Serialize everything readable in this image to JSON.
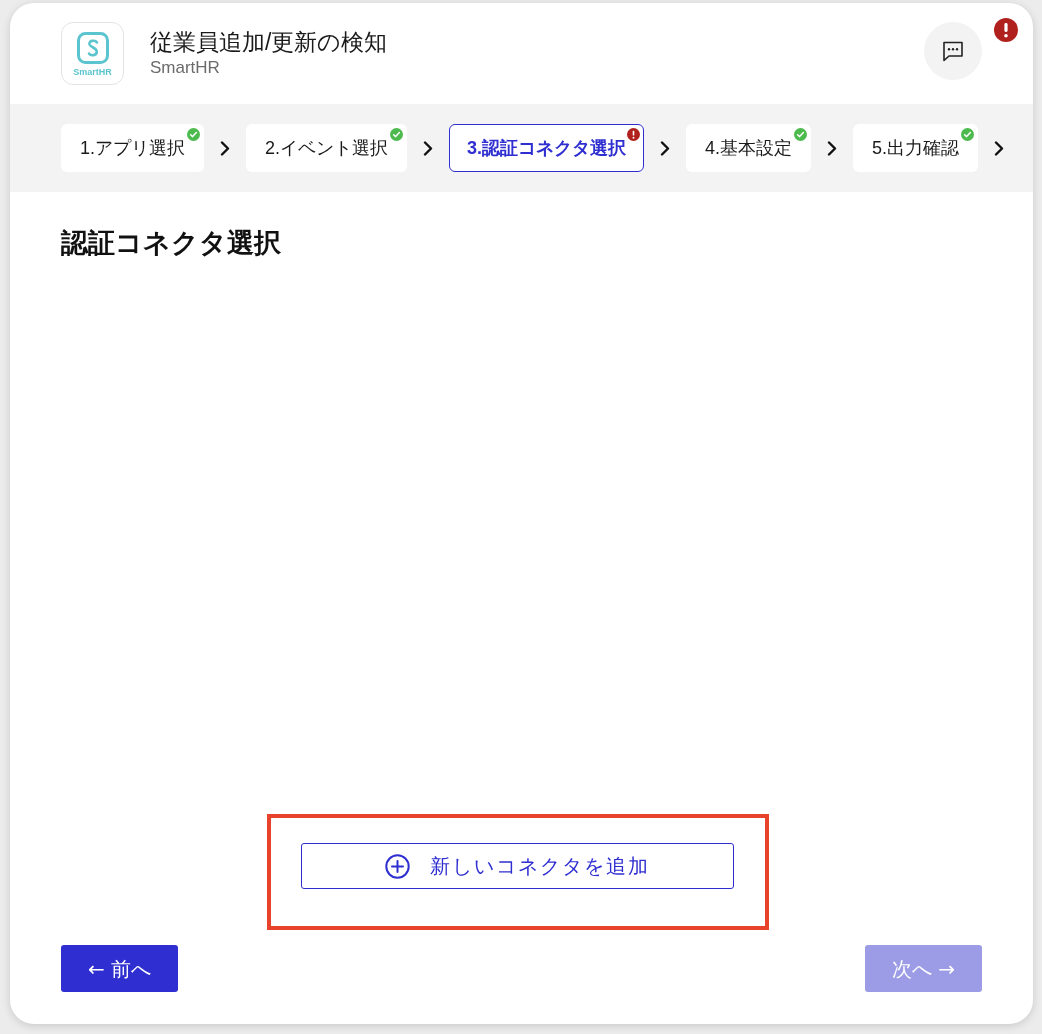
{
  "app": {
    "logo_text": "SmartHR",
    "title": "従業員追加/更新の検知",
    "subtitle": "SmartHR"
  },
  "header": {
    "alert": true
  },
  "steps": [
    {
      "label": "1.アプリ選択",
      "selected": false,
      "completed": true
    },
    {
      "label": "2.イベント選択",
      "selected": false,
      "completed": true
    },
    {
      "label": "3.認証コネクタ選択",
      "selected": true,
      "completed": false
    },
    {
      "label": "4.基本設定",
      "selected": false,
      "completed": true
    },
    {
      "label": "5.出力確認",
      "selected": false,
      "completed": true
    }
  ],
  "section": {
    "title": "認証コネクタ選択"
  },
  "add_connector": {
    "label": "新しいコネクタを追加",
    "highlighted": true
  },
  "footer": {
    "prev": {
      "label": "← 前へ",
      "disabled": false
    },
    "next": {
      "label": "次へ →",
      "disabled": true
    }
  }
}
